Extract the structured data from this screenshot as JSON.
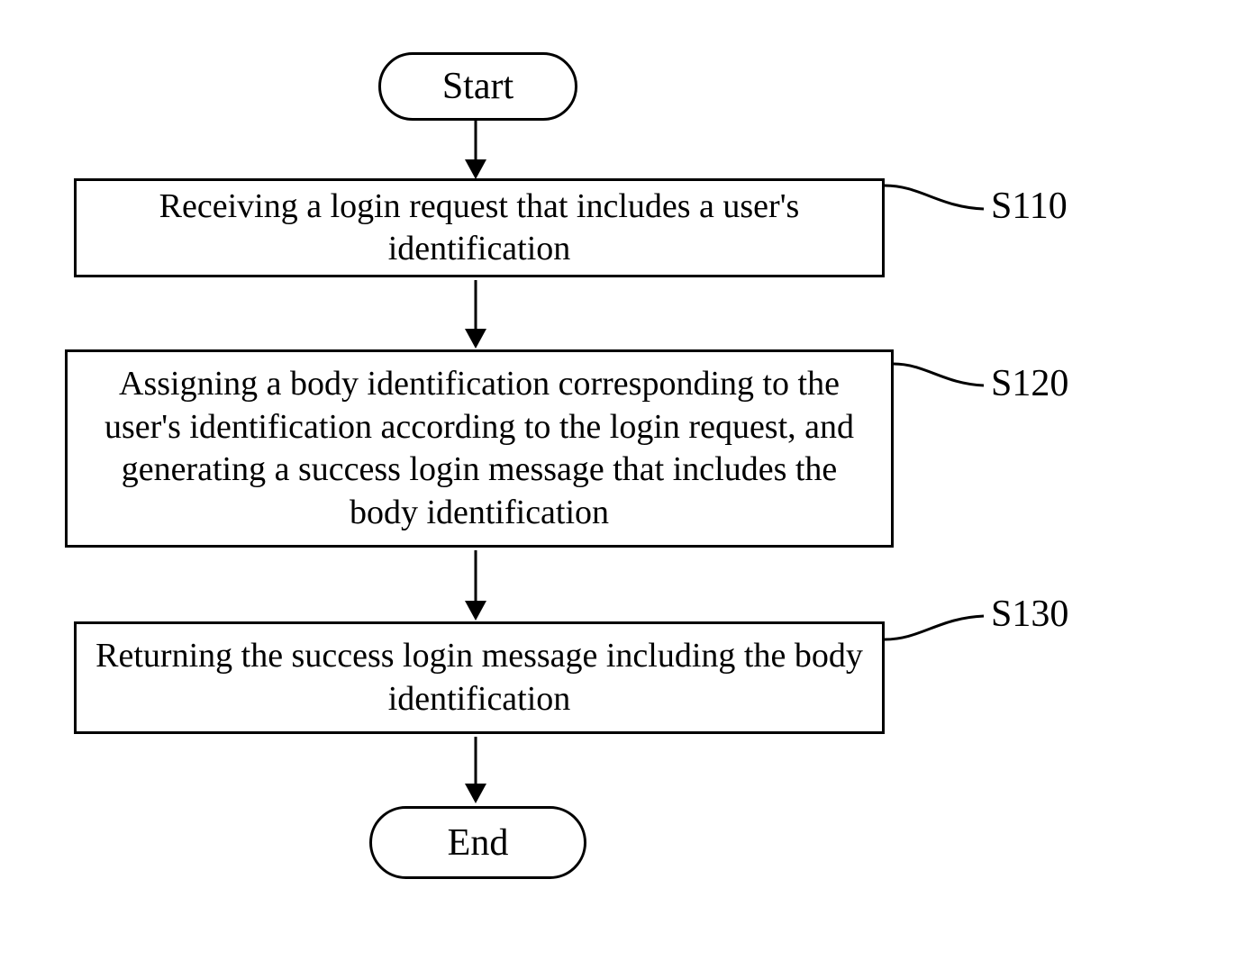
{
  "terminator": {
    "start": "Start",
    "end": "End"
  },
  "steps": {
    "s110": {
      "text": "Receiving a login request that includes a user's identification",
      "label": "S110"
    },
    "s120": {
      "text": "Assigning a body identification corresponding to the user's identification according to the login request, and generating a success login message that includes the body identification",
      "label": "S120"
    },
    "s130": {
      "text": "Returning the success login message including the body identification",
      "label": "S130"
    }
  }
}
